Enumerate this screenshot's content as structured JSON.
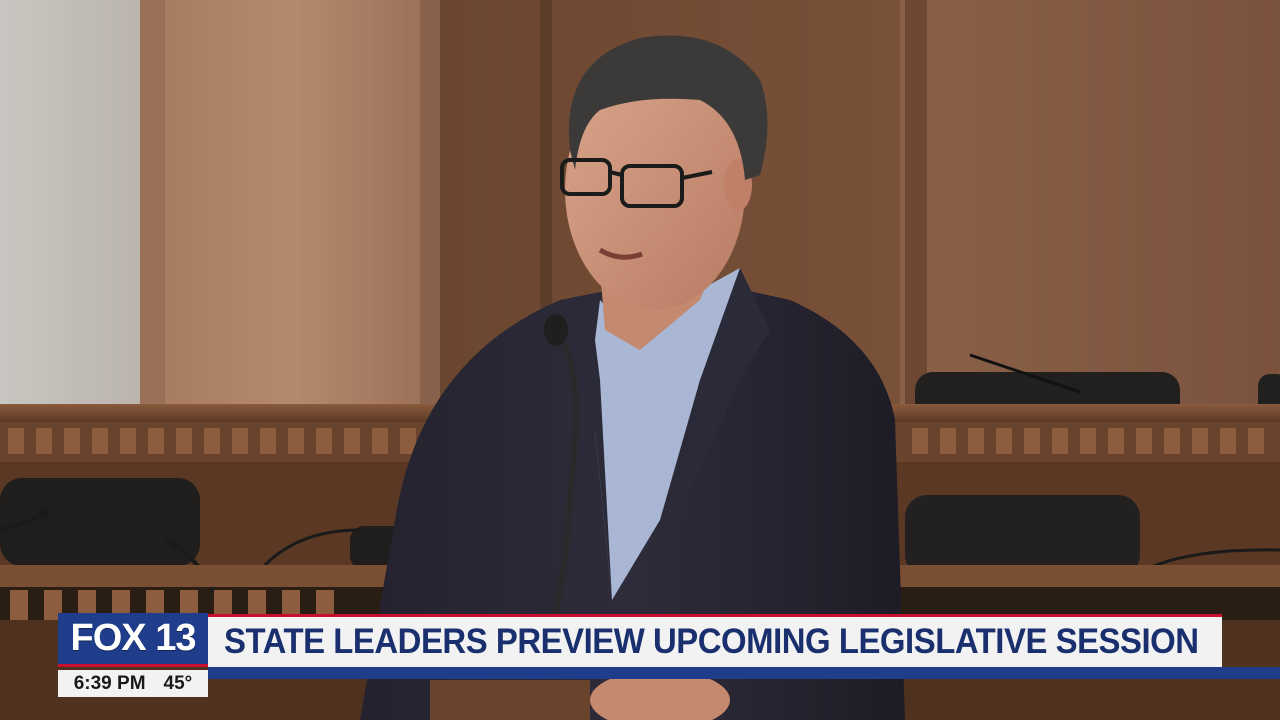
{
  "broadcast": {
    "logo": "FOX 13",
    "headline": "STATE LEADERS PREVIEW UPCOMING LEGISLATIVE SESSION",
    "time": "6:39 PM",
    "temperature": "45°"
  },
  "colors": {
    "brand_blue": "#1f3d8a",
    "brand_red": "#c8102e",
    "bar_background": "#f2f2f2",
    "headline_text": "#1a2f6e"
  },
  "icons": [
    "microphone-icon"
  ]
}
